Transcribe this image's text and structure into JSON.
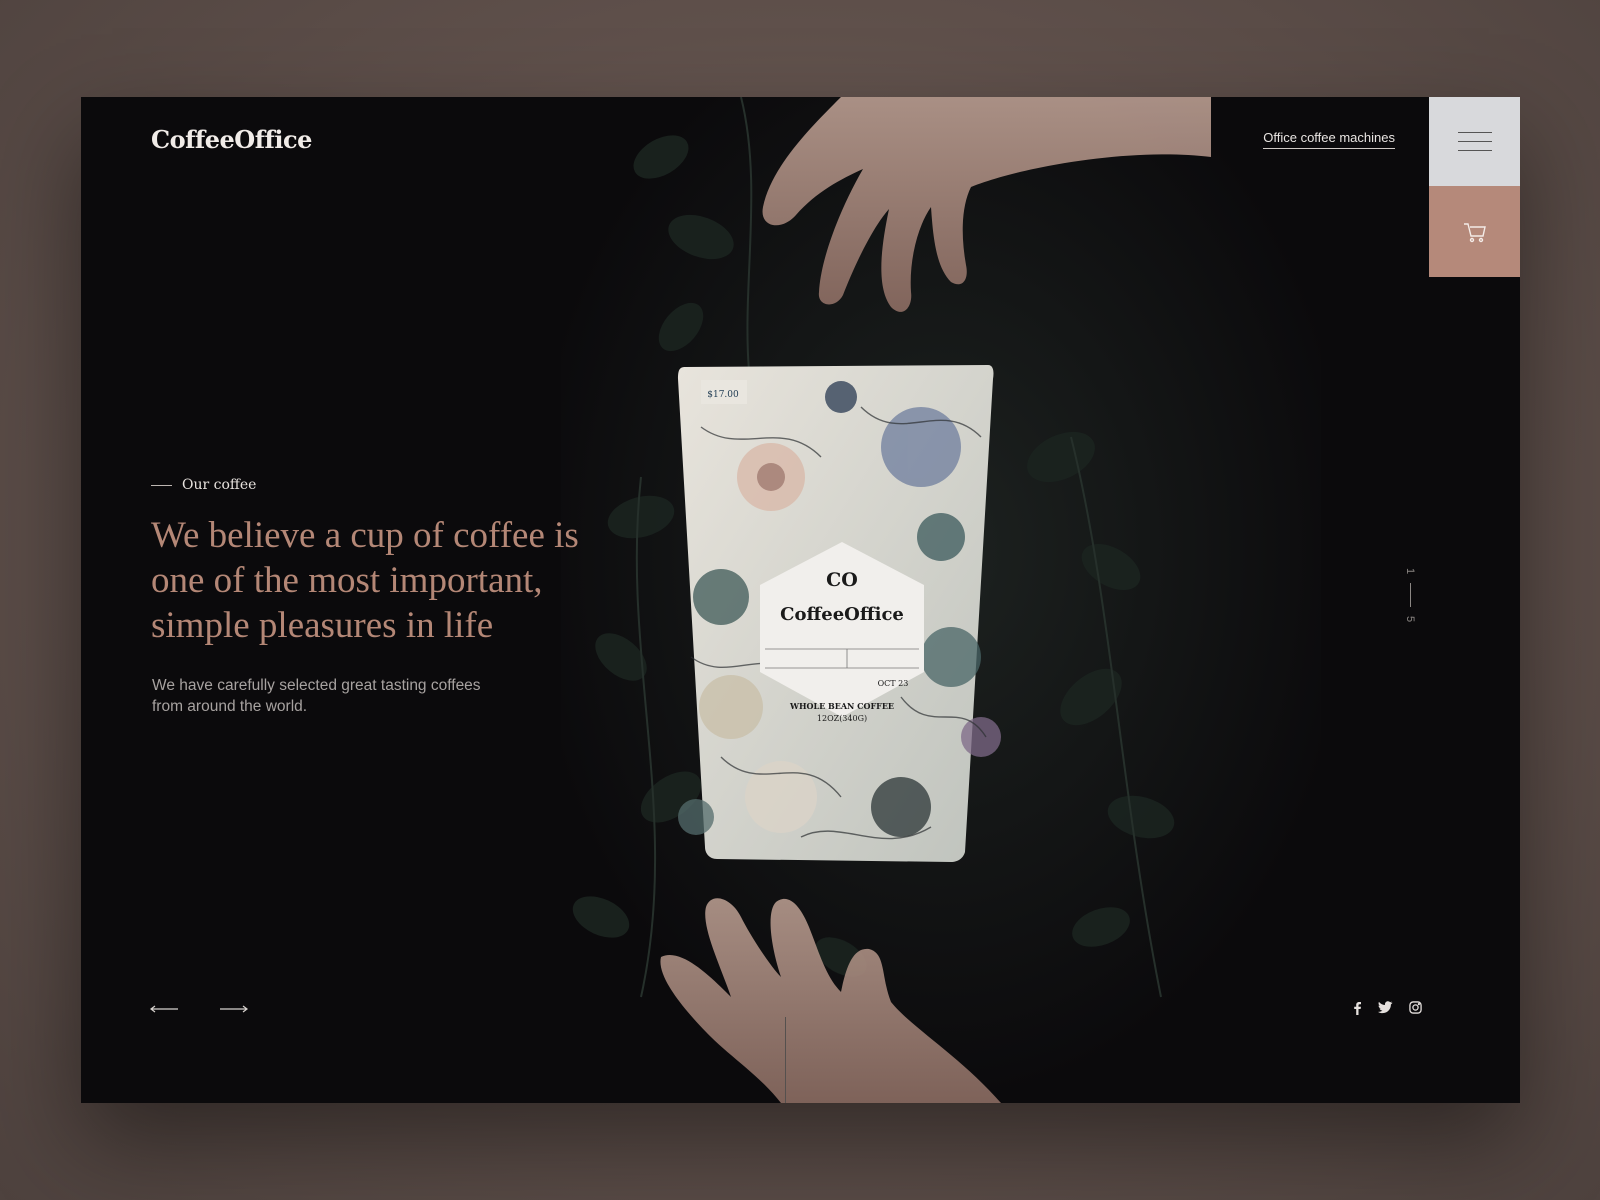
{
  "header": {
    "logo": "CoffeeOffice",
    "nav_link": "Office coffee machines",
    "menu_icon": "hamburger-icon",
    "cart_icon": "cart-icon"
  },
  "hero": {
    "eyebrow": "Our coffee",
    "headline": "We believe a cup of coffee is one of the most important, simple pleasures in life",
    "subtext": "We have carefully selected great tasting coffees from around the world."
  },
  "pager": {
    "current": "1",
    "total": "5"
  },
  "product": {
    "logo_mark": "CO",
    "brand": "CoffeeOffice",
    "price": "$17.00",
    "type": "WHOLE BEAN COFFEE",
    "weight": "12OZ(340G)",
    "date": "OCT 23"
  },
  "social": [
    "facebook-icon",
    "twitter-icon",
    "instagram-icon"
  ],
  "colors": {
    "accent": "#b48776",
    "cart_bg": "#b5897a",
    "menu_bg": "#d8d9dc",
    "frame_bg": "#0b0a0c"
  }
}
